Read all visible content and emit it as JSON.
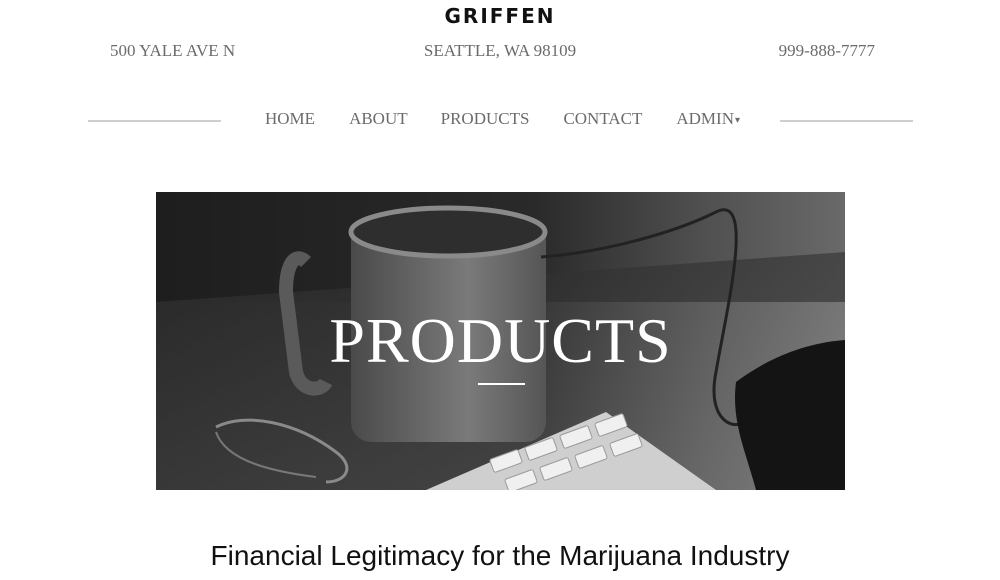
{
  "brand": {
    "name": "GRIFFEN"
  },
  "contact": {
    "address": "500 YALE AVE N",
    "city": "SEATTLE, WA 98109",
    "phone": "999-888-7777"
  },
  "nav": {
    "items": [
      {
        "label": "HOME"
      },
      {
        "label": "ABOUT"
      },
      {
        "label": "PRODUCTS"
      },
      {
        "label": "CONTACT"
      },
      {
        "label": "ADMIN"
      }
    ],
    "admin_dropdown_icon": "caret-down-icon"
  },
  "hero": {
    "title": "PRODUCTS",
    "image": "black-and-white photo of coffee mug, keyboard, cable and hand"
  },
  "main": {
    "heading": "Financial Legitimacy for the Marijuana Industry"
  },
  "colors": {
    "text_gray": "#6b6b6b",
    "rule_gray": "#cfcfcf",
    "heading_dark": "#111111",
    "hero_text": "#ffffff"
  }
}
